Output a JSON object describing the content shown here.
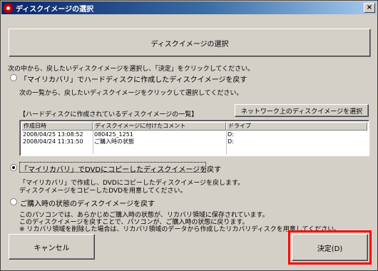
{
  "window": {
    "title": "ディスクイメージの選択",
    "close_glyph": "×"
  },
  "banner": {
    "label": "ディスクイメージの選択"
  },
  "instruction": "次の中から、戻したいディスクイメージを選択し、「決定」をクリックしてください。",
  "option1": {
    "label": "「マイリカバリ」でハードディスクに作成したディスクイメージを戻す",
    "description": "次の一覧から、戻したいディスクイメージをクリックして選択してください。",
    "list_caption": "【ハードディスクに作成されているディスクイメージの一覧】",
    "network_button": "ネットワーク上のディスクイメージを選択",
    "columns": [
      "作成日時",
      "ディスクイメージに付けたコメント",
      "ドライブ"
    ],
    "rows": [
      {
        "date": "2008/04/25 13:08:52",
        "comment": "080425_1251",
        "drive": "D:"
      },
      {
        "date": "2008/04/24 11:31:50",
        "comment": "ご購入時の状態",
        "drive": "D:"
      }
    ]
  },
  "option2": {
    "label": "「マイリカバリ」でDVDにコピーしたディスクイメージを戻す",
    "line1": "「マイリカバリ」で作成し、DVDにコピーしたディスクイメージを戻します。",
    "line2": "ディスクイメージをコピーしたDVDを用意してください。",
    "checked": true
  },
  "option3": {
    "label": "ご購入時の状態のディスクイメージを戻す",
    "line1": "このパソコンでは、あらかじめご購入時の状態が、リカバリ領域に保存されています。",
    "line2": "このディスクイメージを戻すことで、パソコンが、ご購入時の状態に戻ります。",
    "line3": "※ リカバリ領域を削除した場合は、リカバリ領域のデータから作成したリカバリディスクを用意してください。"
  },
  "buttons": {
    "cancel": "キャンセル",
    "ok": "決定(D)"
  },
  "colors": {
    "highlight": "#ff0000",
    "titlebar_start": "#0a246a"
  }
}
